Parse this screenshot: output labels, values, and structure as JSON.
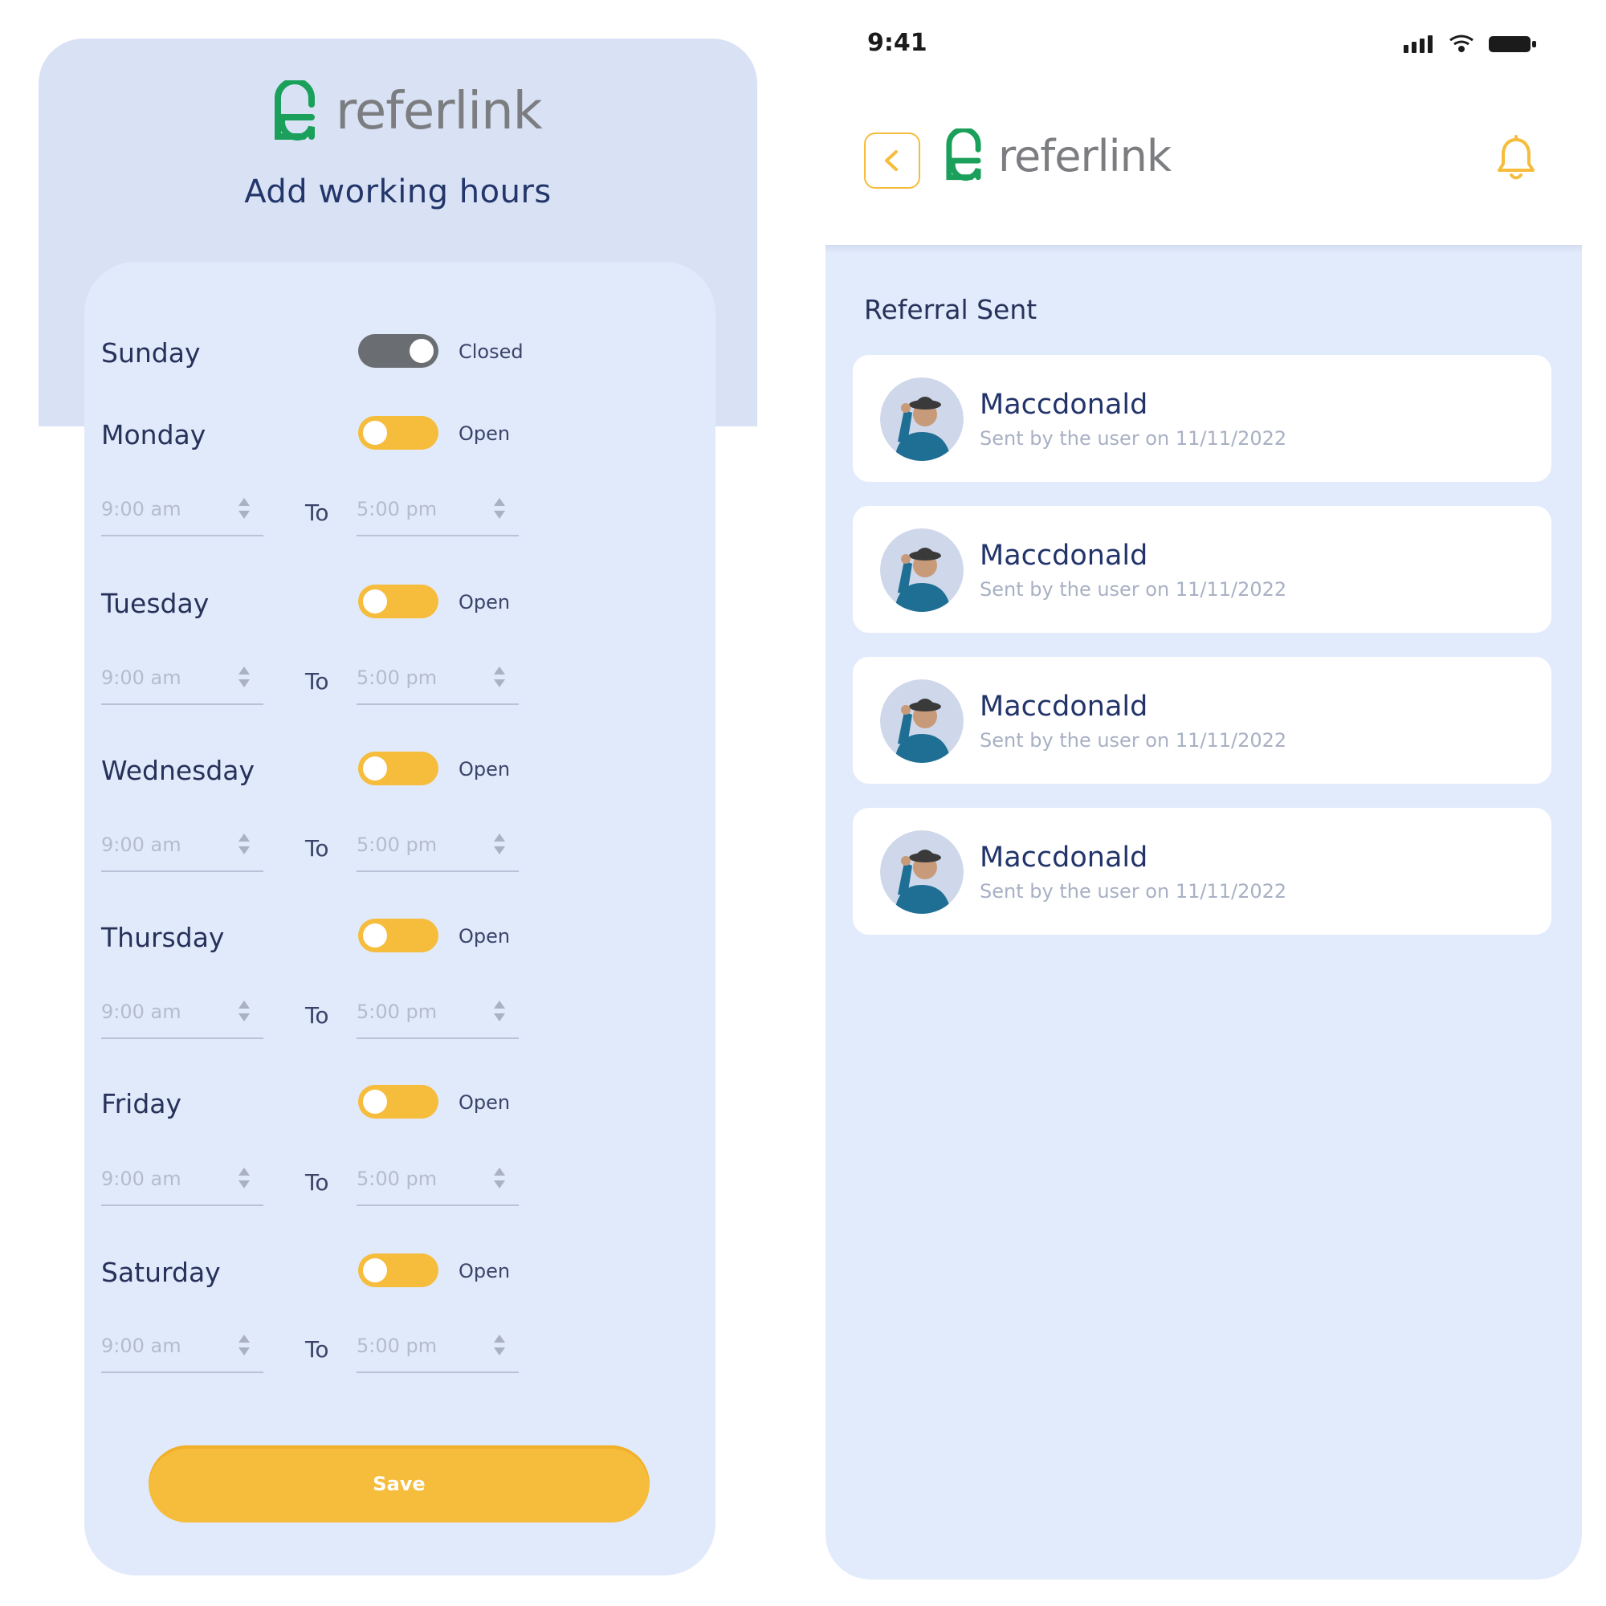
{
  "colors": {
    "accent": "#f6bc3c",
    "brand_green": "#1aa05a",
    "navy": "#23356a",
    "panel_bg": "#e1eafb",
    "header_bg": "#d8e2f4",
    "toggle_off": "#6a6d72"
  },
  "hours_screen": {
    "brand": "referlink",
    "title": "Add working hours",
    "to_label": "To",
    "days": [
      {
        "name": "Sunday",
        "status": "Closed",
        "open": false
      },
      {
        "name": "Monday",
        "status": "Open",
        "open": true,
        "from": "9:00 am",
        "to": "5:00 pm"
      },
      {
        "name": "Tuesday",
        "status": "Open",
        "open": true,
        "from": "9:00 am",
        "to": "5:00 pm"
      },
      {
        "name": "Wednesday",
        "status": "Open",
        "open": true,
        "from": "9:00 am",
        "to": "5:00 pm"
      },
      {
        "name": "Thursday",
        "status": "Open",
        "open": true,
        "from": "9:00 am",
        "to": "5:00 pm"
      },
      {
        "name": "Friday",
        "status": "Open",
        "open": true,
        "from": "9:00 am",
        "to": "5:00 pm"
      },
      {
        "name": "Saturday",
        "status": "Open",
        "open": true,
        "from": "9:00 am",
        "to": "5:00 pm"
      }
    ],
    "save_label": "Save"
  },
  "referral_screen": {
    "status_time": "9:41",
    "brand": "referlink",
    "icons": {
      "back": "chevron-left-icon",
      "notifications": "bell-icon"
    },
    "section_title": "Referral Sent",
    "referrals": [
      {
        "name": "Maccdonald",
        "meta": "Sent by the user on 11/11/2022"
      },
      {
        "name": "Maccdonald",
        "meta": "Sent by the user on 11/11/2022"
      },
      {
        "name": "Maccdonald",
        "meta": "Sent by the user on 11/11/2022"
      },
      {
        "name": "Maccdonald",
        "meta": "Sent by the user on 11/11/2022"
      }
    ]
  }
}
